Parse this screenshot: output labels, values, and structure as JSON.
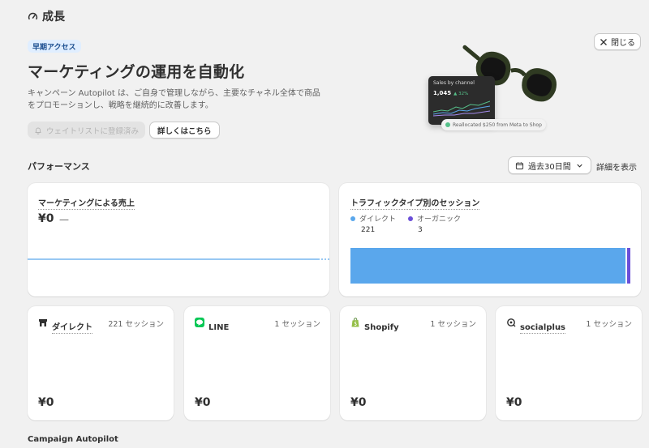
{
  "page": {
    "title": "成長"
  },
  "hero": {
    "badge": "早期アクセス",
    "title": "マーケティングの運用を自動化",
    "description": "キャンペーン Autopilot は、ご自身で管理しながら、主要なチャネル全体で商品をプロモーションし、戦略を継続的に改善します。",
    "waitlist_button": "ウェイトリストに登録済み",
    "learn_more_button": "詳しくはこちら",
    "close_button": "閉じる",
    "illustration": {
      "card_title": "Sales by channel",
      "card_value": "1,045",
      "card_change": "▲ 32%",
      "reallocated": "Reallocated $250 from Meta to Shop"
    }
  },
  "performance": {
    "label": "パフォーマンス",
    "date_range": "過去30日間",
    "details_link": "詳細を表示"
  },
  "marketing_sales": {
    "title": "マーケティングによる売上",
    "value": "¥0",
    "change": "—"
  },
  "traffic": {
    "title": "トラフィックタイプ別のセッション",
    "legend": [
      {
        "label": "ダイレクト",
        "value": "221",
        "color": "#5aa7ec"
      },
      {
        "label": "オーガニック",
        "value": "3",
        "color": "#6b4fd8"
      }
    ]
  },
  "channels": [
    {
      "name": "ダイレクト",
      "sessions": "221 セッション",
      "value": "¥0",
      "icon": "store-icon"
    },
    {
      "name": "LINE",
      "sessions": "1 セッション",
      "value": "¥0",
      "icon": "line-icon"
    },
    {
      "name": "Shopify",
      "sessions": "1 セッション",
      "value": "¥0",
      "icon": "shopify-bag-icon"
    },
    {
      "name": "socialplus",
      "sessions": "1 セッション",
      "value": "¥0",
      "icon": "socialplus-icon"
    }
  ],
  "campaign_autopilot": {
    "label": "Campaign Autopilot"
  },
  "colors": {
    "accent_blue": "#5aa7ec",
    "accent_purple": "#6b4fd8",
    "line_green": "#06c755",
    "shopify_green": "#95bf47"
  }
}
